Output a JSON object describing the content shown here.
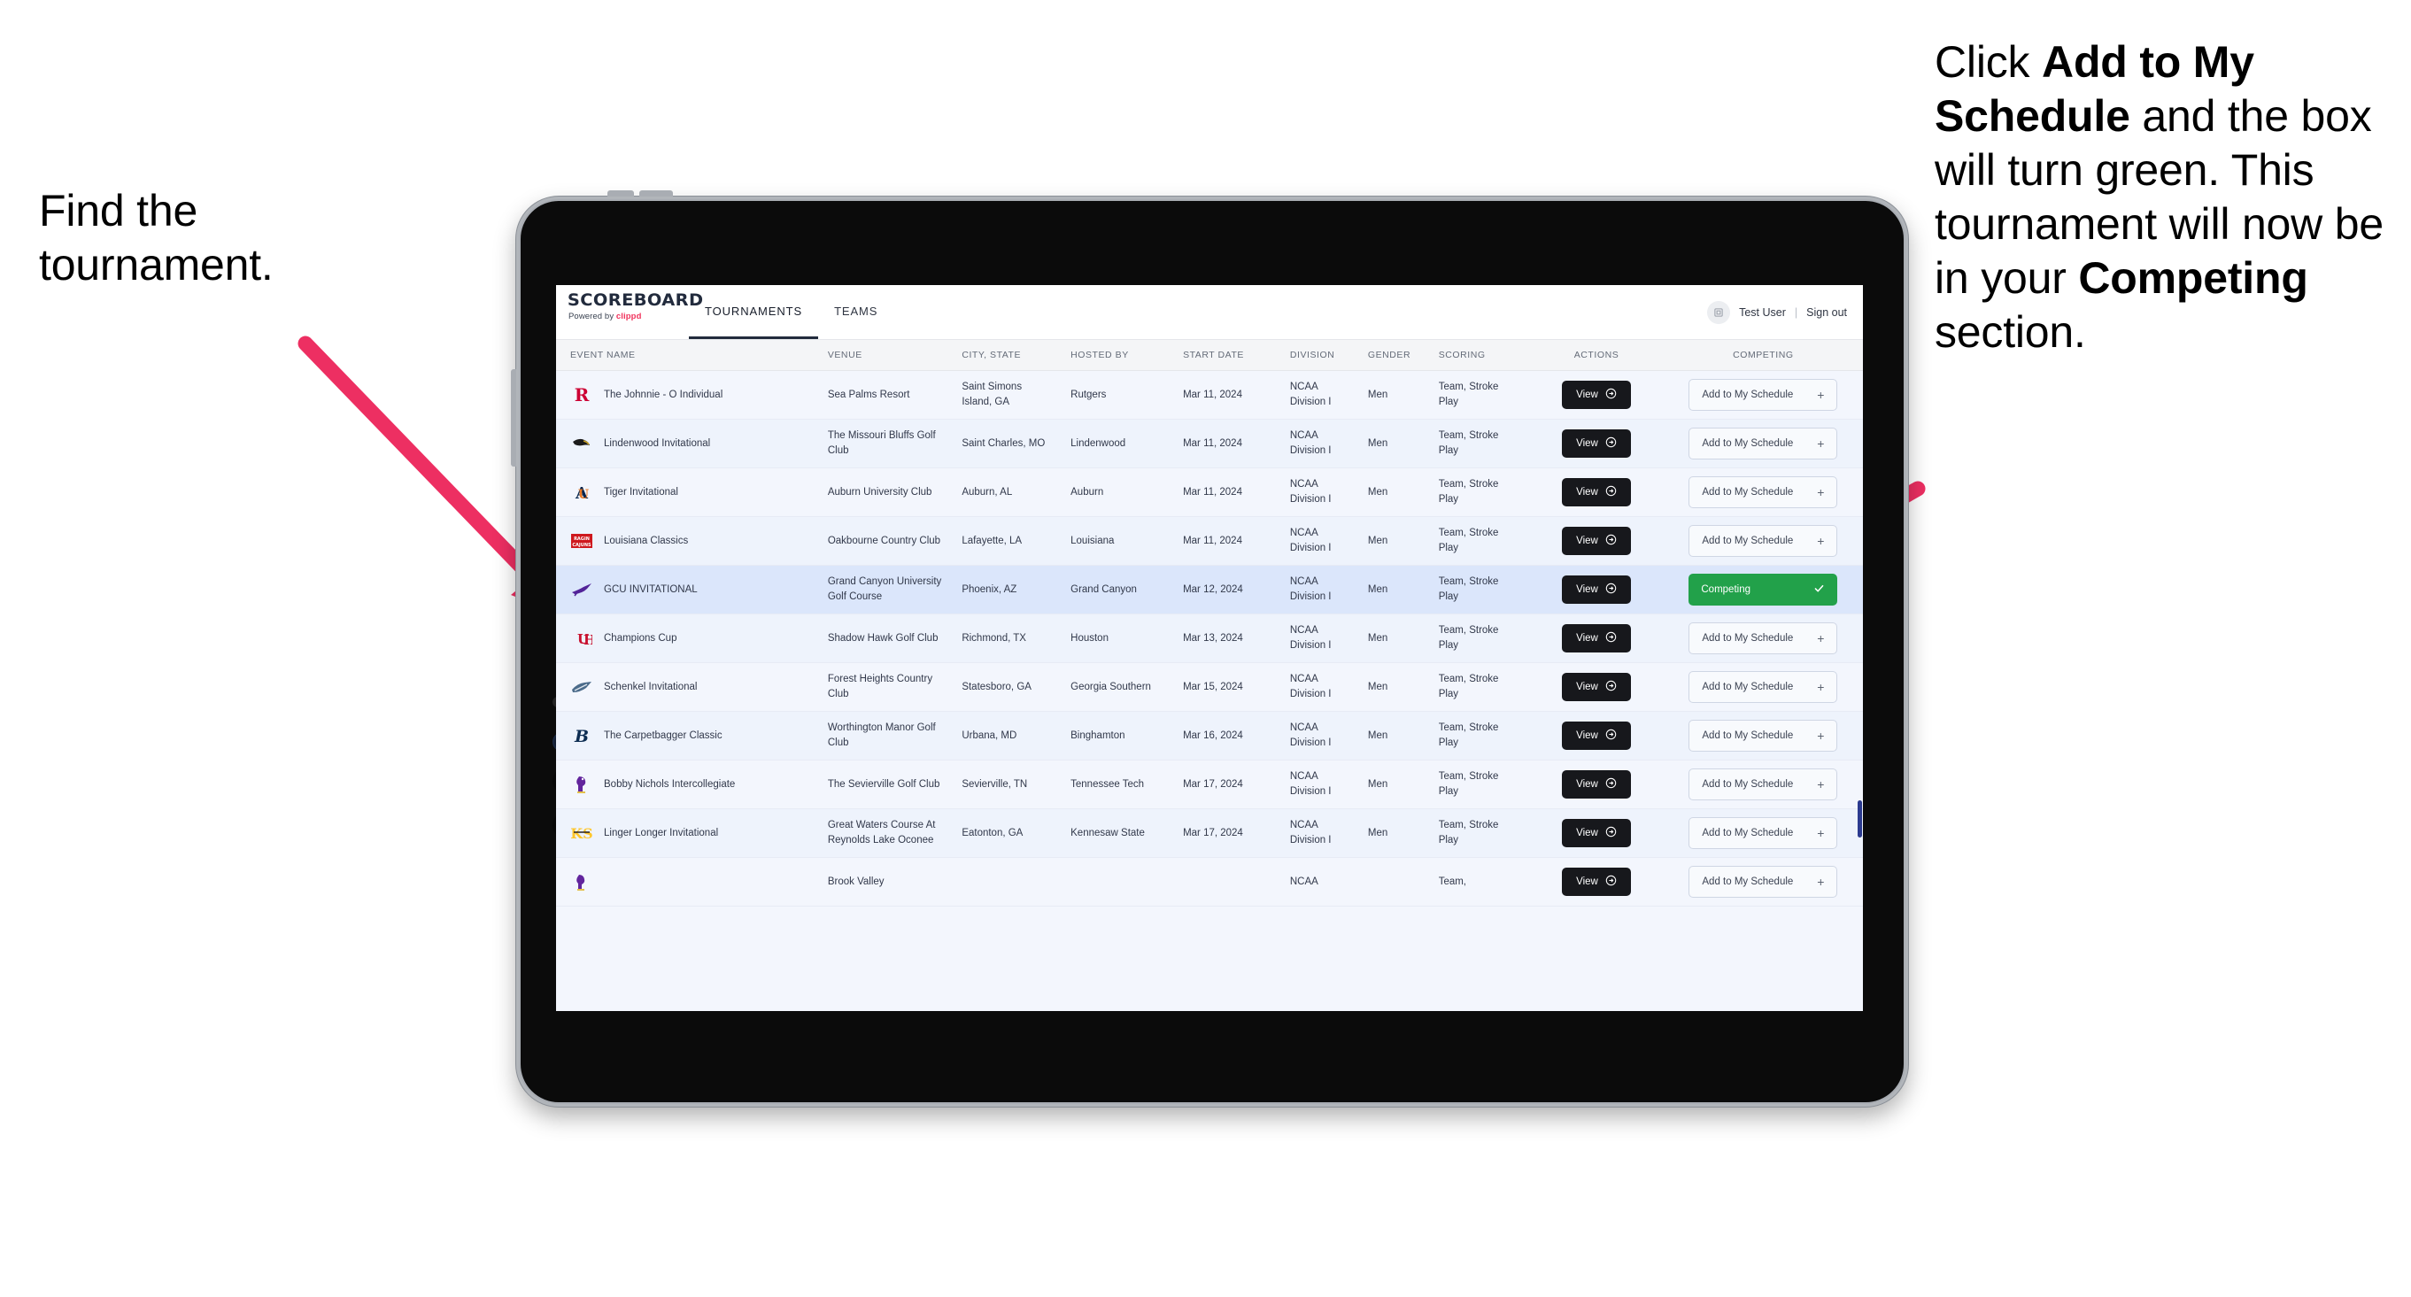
{
  "annotations": {
    "left": {
      "line1": "Find the",
      "line2": "tournament."
    },
    "right": {
      "seg1": "Click ",
      "bold1": "Add to My Schedule",
      "seg2": " and the box will turn green. This tournament will now be in your ",
      "bold2": "Competing",
      "seg3": " section."
    },
    "arrow_color": "#ED2F62"
  },
  "app": {
    "brand": {
      "name": "SCOREBOARD",
      "powered_prefix": "Powered by ",
      "powered_name": "clippd"
    },
    "tabs": [
      {
        "label": "TOURNAMENTS",
        "active": true
      },
      {
        "label": "TEAMS",
        "active": false
      }
    ],
    "user": {
      "avatar_icon": "user-avatar-icon",
      "name": "Test User",
      "separator": "|",
      "sign_out": "Sign out"
    },
    "table": {
      "columns": [
        "EVENT NAME",
        "VENUE",
        "CITY, STATE",
        "HOSTED BY",
        "START DATE",
        "DIVISION",
        "GENDER",
        "SCORING",
        "ACTIONS",
        "COMPETING"
      ],
      "view_label": "View",
      "add_label": "Add to My Schedule",
      "add_icon": "plus-icon",
      "competing_label": "Competing",
      "competing_icon": "check-icon",
      "competing_color": "#22a14a",
      "rows": [
        {
          "event": "The Johnnie - O Individual",
          "venue": "Sea Palms Resort",
          "city": "Saint Simons Island, GA",
          "host": "Rutgers",
          "date": "Mar 11, 2024",
          "division": "NCAA Division I",
          "gender": "Men",
          "scoring": "Team, Stroke Play",
          "state": "add",
          "logo": "rutgers-logo"
        },
        {
          "event": "Lindenwood Invitational",
          "venue": "The Missouri Bluffs Golf Club",
          "city": "Saint Charles, MO",
          "host": "Lindenwood",
          "date": "Mar 11, 2024",
          "division": "NCAA Division I",
          "gender": "Men",
          "scoring": "Team, Stroke Play",
          "state": "add",
          "logo": "lindenwood-logo"
        },
        {
          "event": "Tiger Invitational",
          "venue": "Auburn University Club",
          "city": "Auburn, AL",
          "host": "Auburn",
          "date": "Mar 11, 2024",
          "division": "NCAA Division I",
          "gender": "Men",
          "scoring": "Team, Stroke Play",
          "state": "add",
          "logo": "auburn-logo"
        },
        {
          "event": "Louisiana Classics",
          "venue": "Oakbourne Country Club",
          "city": "Lafayette, LA",
          "host": "Louisiana",
          "date": "Mar 11, 2024",
          "division": "NCAA Division I",
          "gender": "Men",
          "scoring": "Team, Stroke Play",
          "state": "add",
          "logo": "ragin-cajuns-logo"
        },
        {
          "event": "GCU INVITATIONAL",
          "venue": "Grand Canyon University Golf Course",
          "city": "Phoenix, AZ",
          "host": "Grand Canyon",
          "date": "Mar 12, 2024",
          "division": "NCAA Division I",
          "gender": "Men",
          "scoring": "Team, Stroke Play",
          "state": "competing",
          "logo": "grand-canyon-logo"
        },
        {
          "event": "Champions Cup",
          "venue": "Shadow Hawk Golf Club",
          "city": "Richmond, TX",
          "host": "Houston",
          "date": "Mar 13, 2024",
          "division": "NCAA Division I",
          "gender": "Men",
          "scoring": "Team, Stroke Play",
          "state": "add",
          "logo": "houston-logo"
        },
        {
          "event": "Schenkel Invitational",
          "venue": "Forest Heights Country Club",
          "city": "Statesboro, GA",
          "host": "Georgia Southern",
          "date": "Mar 15, 2024",
          "division": "NCAA Division I",
          "gender": "Men",
          "scoring": "Team, Stroke Play",
          "state": "add",
          "logo": "georgia-southern-logo"
        },
        {
          "event": "The Carpetbagger Classic",
          "venue": "Worthington Manor Golf Club",
          "city": "Urbana, MD",
          "host": "Binghamton",
          "date": "Mar 16, 2024",
          "division": "NCAA Division I",
          "gender": "Men",
          "scoring": "Team, Stroke Play",
          "state": "add",
          "logo": "binghamton-logo"
        },
        {
          "event": "Bobby Nichols Intercollegiate",
          "venue": "The Sevierville Golf Club",
          "city": "Sevierville, TN",
          "host": "Tennessee Tech",
          "date": "Mar 17, 2024",
          "division": "NCAA Division I",
          "gender": "Men",
          "scoring": "Team, Stroke Play",
          "state": "add",
          "logo": "tennessee-tech-logo"
        },
        {
          "event": "Linger Longer Invitational",
          "venue": "Great Waters Course At Reynolds Lake Oconee",
          "city": "Eatonton, GA",
          "host": "Kennesaw State",
          "date": "Mar 17, 2024",
          "division": "NCAA Division I",
          "gender": "Men",
          "scoring": "Team, Stroke Play",
          "state": "add",
          "logo": "kennesaw-state-logo"
        },
        {
          "event": "",
          "venue": "Brook Valley",
          "city": "",
          "host": "",
          "date": "",
          "division": "NCAA",
          "gender": "",
          "scoring": "Team,",
          "state": "add",
          "logo": "clipped-logo"
        }
      ]
    }
  }
}
